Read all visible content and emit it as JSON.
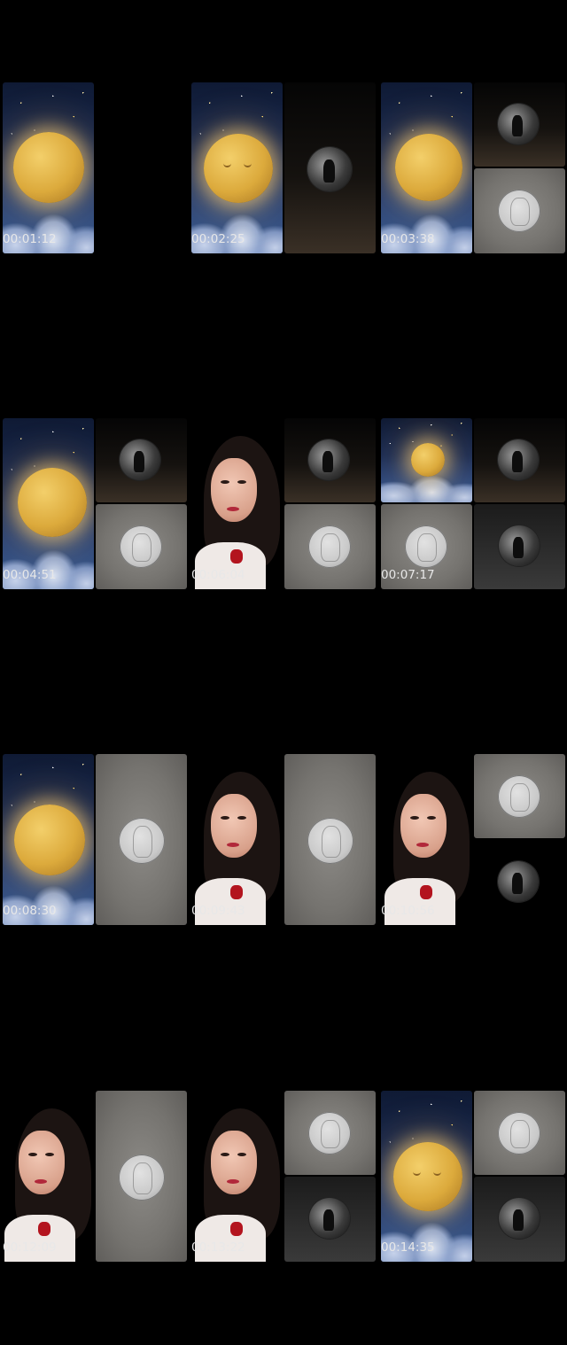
{
  "timestamps": [
    "00:01:12",
    "00:02:25",
    "00:03:38",
    "00:04:51",
    "00:06:04",
    "00:07:17",
    "00:08:30",
    "00:09:43",
    "00:10:56",
    "00:12:09",
    "00:13:22",
    "00:14:35"
  ],
  "colors": {
    "background": "#000000",
    "moon": "#dcaa3c",
    "sky": "#1a2c55",
    "gray_panel": "#75736f"
  }
}
